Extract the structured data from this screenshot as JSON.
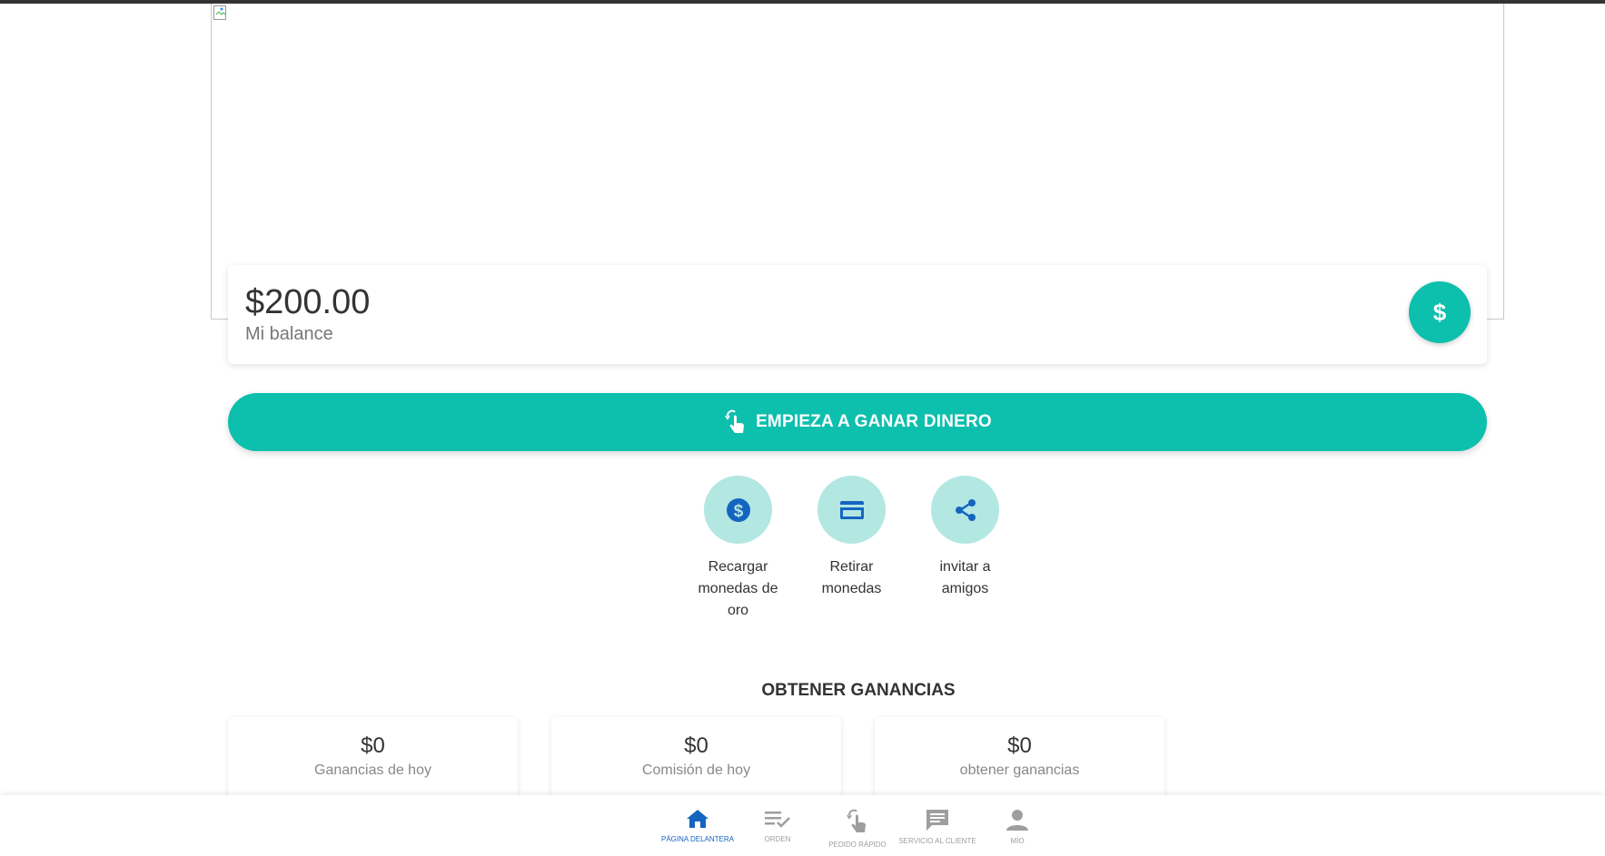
{
  "balance": {
    "amount": "$200.00",
    "label": "Mi balance"
  },
  "earn_button": {
    "label": "EMPIEZA A GANAR DINERO"
  },
  "actions": [
    {
      "label": "Recargar monedas de oro",
      "icon": "dollar-circle-icon"
    },
    {
      "label": "Retirar monedas",
      "icon": "credit-card-icon"
    },
    {
      "label": "invitar a amigos",
      "icon": "share-icon"
    }
  ],
  "earnings": {
    "title": "OBTENER GANANCIAS",
    "stats": [
      {
        "value": "$0",
        "label": "Ganancias de hoy"
      },
      {
        "value": "$0",
        "label": "Comisión de hoy"
      },
      {
        "value": "$0",
        "label": "obtener ganancias"
      }
    ]
  },
  "nav": {
    "items": [
      {
        "label": "PÁGINA DELANTERA",
        "icon": "home-icon",
        "active": true
      },
      {
        "label": "ORDEN",
        "icon": "order-list-icon",
        "active": false
      },
      {
        "label": "PEDIDO RÁPIDO",
        "icon": "tap-icon",
        "active": false
      },
      {
        "label": "SERVICIO AL CLIENTE",
        "icon": "chat-icon",
        "active": false
      },
      {
        "label": "MÍO",
        "icon": "person-icon",
        "active": false
      }
    ]
  },
  "colors": {
    "accent": "#0dbfad",
    "accent_light": "#b3e7e2",
    "icon_blue": "#1565c0",
    "nav_inactive": "#9e9e9e"
  }
}
